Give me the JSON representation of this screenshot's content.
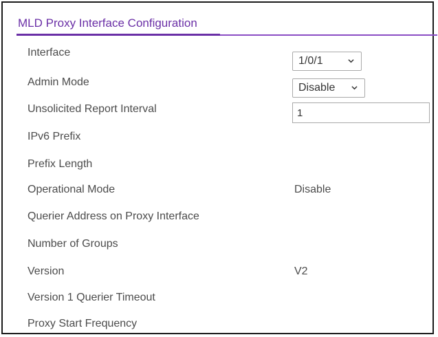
{
  "panel": {
    "title": "MLD Proxy Interface Configuration"
  },
  "fields": {
    "interface": {
      "label": "Interface",
      "value": "1/0/1"
    },
    "admin_mode": {
      "label": "Admin Mode",
      "value": "Disable"
    },
    "unsolicited_report_interval": {
      "label": "Unsolicited Report Interval",
      "value": "1"
    },
    "ipv6_prefix": {
      "label": "IPv6 Prefix",
      "value": ""
    },
    "prefix_length": {
      "label": "Prefix Length",
      "value": ""
    },
    "operational_mode": {
      "label": "Operational Mode",
      "value": "Disable"
    },
    "querier_address": {
      "label": "Querier Address on Proxy Interface",
      "value": ""
    },
    "number_of_groups": {
      "label": "Number of Groups",
      "value": ""
    },
    "version": {
      "label": "Version",
      "value": "V2"
    },
    "version1_querier_timeout": {
      "label": "Version 1 Querier Timeout",
      "value": ""
    },
    "proxy_start_frequency": {
      "label": "Proxy Start Frequency",
      "value": ""
    }
  },
  "icons": {
    "dropdown": "chevron-down-icon"
  },
  "colors": {
    "accent": "#6a2fa6",
    "text": "#4b4b4b"
  }
}
